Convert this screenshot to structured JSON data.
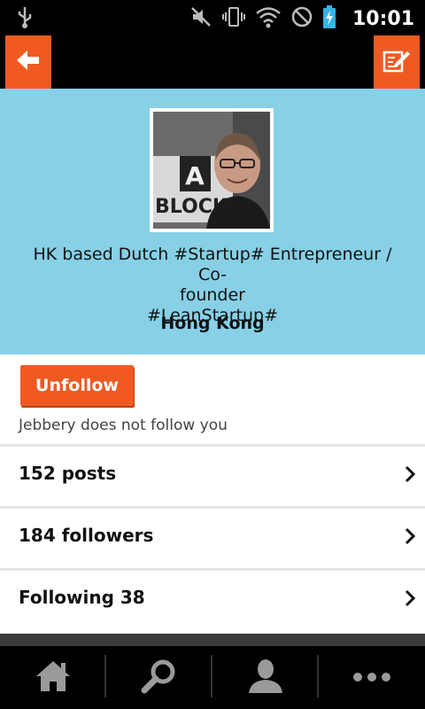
{
  "status_bar": {
    "time": "10:01",
    "icons": [
      "usb-icon",
      "mute-icon",
      "vibrate-icon",
      "wifi-icon",
      "no-sim-icon",
      "battery-charging-icon"
    ]
  },
  "action_bar": {
    "back_icon": "arrow-left-icon",
    "compose_icon": "edit-icon"
  },
  "profile": {
    "bio_line1": "HK based Dutch #Startup# Entrepreneur / Co-",
    "bio_line2": "founder",
    "bio_line3": "#LeanStartup#",
    "location": "Hong Kong",
    "avatar_sign_text": "A BLOCK"
  },
  "follow": {
    "button_label": "Unfollow",
    "status_text": "Jebbery does not follow you"
  },
  "stats": [
    {
      "label": "152 posts"
    },
    {
      "label": "184 followers"
    },
    {
      "label": "Following 38"
    }
  ],
  "tabs": [
    {
      "icon": "home-icon"
    },
    {
      "icon": "search-icon"
    },
    {
      "icon": "profile-icon"
    },
    {
      "icon": "more-icon"
    }
  ],
  "colors": {
    "accent": "#f05a22",
    "header_bg": "#87d0e6",
    "bar_bg": "#000000"
  }
}
